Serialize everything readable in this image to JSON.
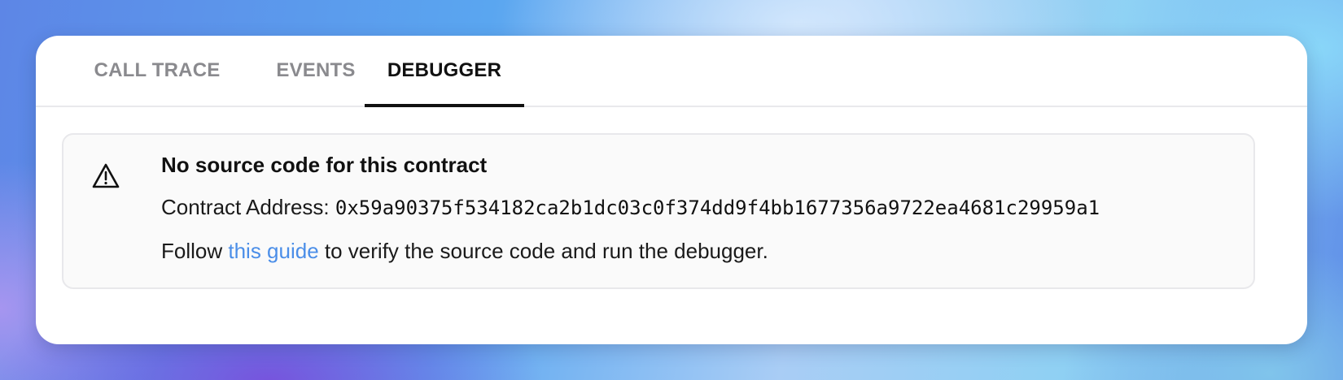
{
  "tabs": [
    {
      "label": "CALL TRACE",
      "active": false
    },
    {
      "label": "EVENTS",
      "active": false
    },
    {
      "label": "DEBUGGER",
      "active": true
    }
  ],
  "notice": {
    "icon": "warning-triangle-icon",
    "title": "No source code for this contract",
    "address_label": "Contract Address: ",
    "address_value": "0x59a90375f534182ca2b1dc03c0f374dd9f4bb1677356a9722ea4681c29959a1",
    "guide_prefix": "Follow ",
    "guide_link": "this guide",
    "guide_suffix": " to verify the source code and run the debugger."
  },
  "colors": {
    "link": "#4b8ee8",
    "active_tab": "#111111",
    "inactive_tab": "#8a8a8e"
  }
}
